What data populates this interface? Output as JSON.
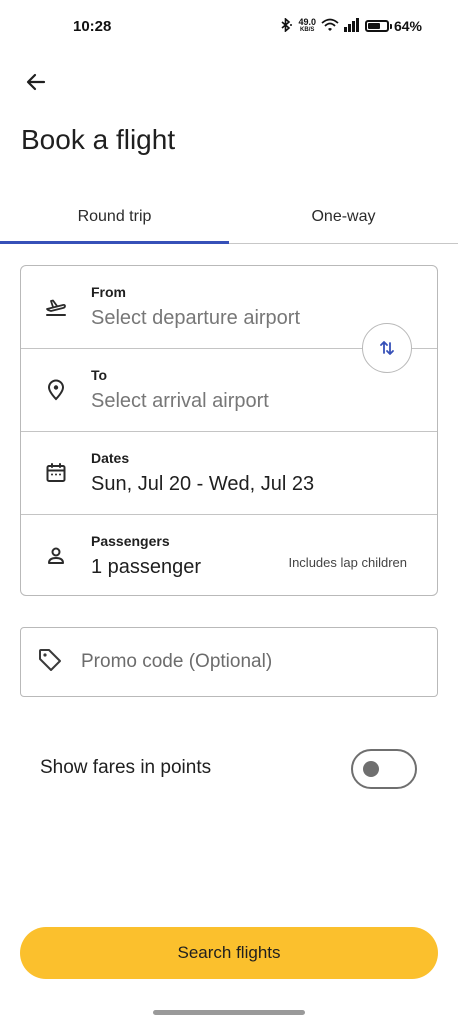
{
  "status_bar": {
    "time": "10:28",
    "net_speed_value": "49.0",
    "net_speed_unit": "KB/S",
    "battery": "64%",
    "battery_level": 0.64
  },
  "header": {
    "title": "Book a flight"
  },
  "tabs": [
    {
      "label": "Round trip",
      "active": true
    },
    {
      "label": "One-way",
      "active": false
    }
  ],
  "form": {
    "from": {
      "label": "From",
      "placeholder": "Select departure airport"
    },
    "to": {
      "label": "To",
      "placeholder": "Select arrival airport"
    },
    "dates": {
      "label": "Dates",
      "value": "Sun, Jul 20 - Wed, Jul 23"
    },
    "passengers": {
      "label": "Passengers",
      "value": "1 passenger",
      "note": "Includes lap children"
    }
  },
  "promo": {
    "placeholder": "Promo code (Optional)"
  },
  "points": {
    "label": "Show fares in points",
    "enabled": false
  },
  "actions": {
    "search_label": "Search flights"
  },
  "colors": {
    "accent": "#3650b8",
    "search_button": "#fbc02d"
  }
}
